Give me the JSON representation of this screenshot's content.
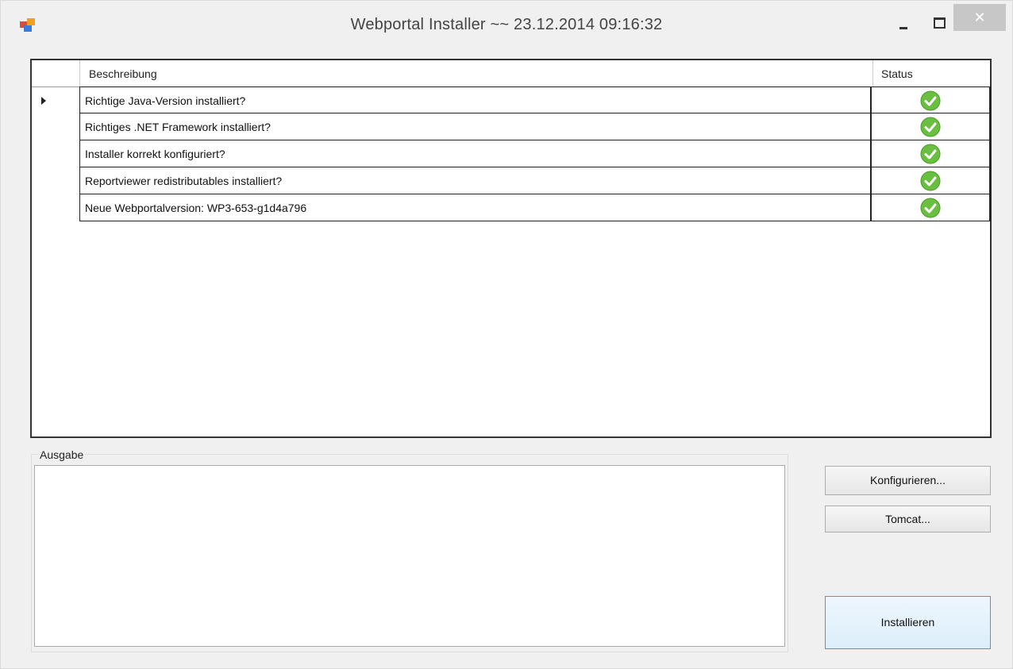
{
  "window": {
    "title": "Webportal Installer ~~ 23.12.2014 09:16:32",
    "close_glyph": "✕"
  },
  "grid": {
    "headers": {
      "description": "Beschreibung",
      "status": "Status"
    },
    "rows": [
      {
        "description": "Richtige Java-Version installiert?",
        "status_icon": "check-icon",
        "selected": true
      },
      {
        "description": "Richtiges .NET Framework installiert?",
        "status_icon": "check-icon",
        "selected": false
      },
      {
        "description": "Installer korrekt konfiguriert?",
        "status_icon": "check-icon",
        "selected": false
      },
      {
        "description": "Reportviewer redistributables installiert?",
        "status_icon": "check-icon",
        "selected": false
      },
      {
        "description": "Neue Webportalversion: WP3-653-g1d4a796",
        "status_icon": "check-icon",
        "selected": false
      }
    ]
  },
  "output": {
    "label": "Ausgabe",
    "text": ""
  },
  "buttons": {
    "configure": "Konfigurieren...",
    "tomcat": "Tomcat...",
    "install": "Installieren"
  },
  "colors": {
    "check_green": "#6abf40",
    "accent_border": "#3c9ee0"
  }
}
